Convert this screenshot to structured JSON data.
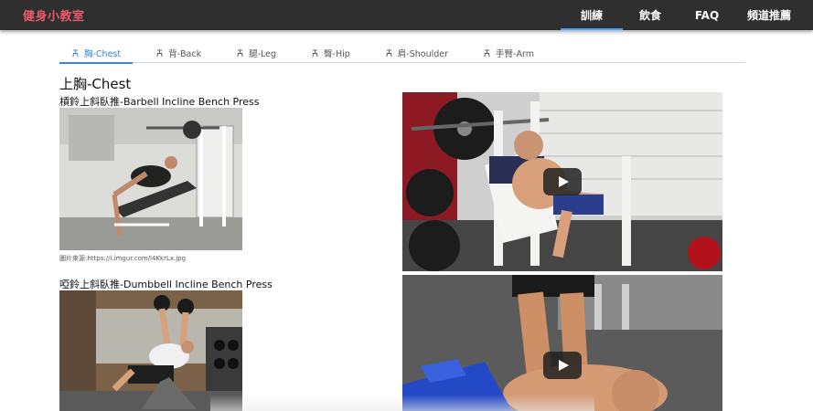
{
  "brand": "健身小教室",
  "nav": [
    {
      "label": "訓練",
      "active": true
    },
    {
      "label": "飲食",
      "active": false
    },
    {
      "label": "FAQ",
      "active": false
    },
    {
      "label": "頻道推薦",
      "active": false
    }
  ],
  "tabs": [
    {
      "label": "胸-Chest",
      "active": true
    },
    {
      "label": "背-Back",
      "active": false
    },
    {
      "label": "腿-Leg",
      "active": false
    },
    {
      "label": "臀-Hip",
      "active": false
    },
    {
      "label": "肩-Shoulder",
      "active": false
    },
    {
      "label": "手臂-Arm",
      "active": false
    }
  ],
  "section": {
    "title": "上胸-Chest",
    "exercises": [
      {
        "title": "槓鈴上斜臥推-Barbell Incline Bench Press",
        "caption": "圖片來源:https://i.imgur.com/l4KkrLx.jpg"
      },
      {
        "title": "啞鈴上斜臥推-Dumbbell Incline Bench Press"
      }
    ]
  },
  "colors": {
    "brand": "#e8596b",
    "topbar": "#2f2f2f",
    "accent": "#3b83d6",
    "nav_indicator": "#4da3ff"
  }
}
